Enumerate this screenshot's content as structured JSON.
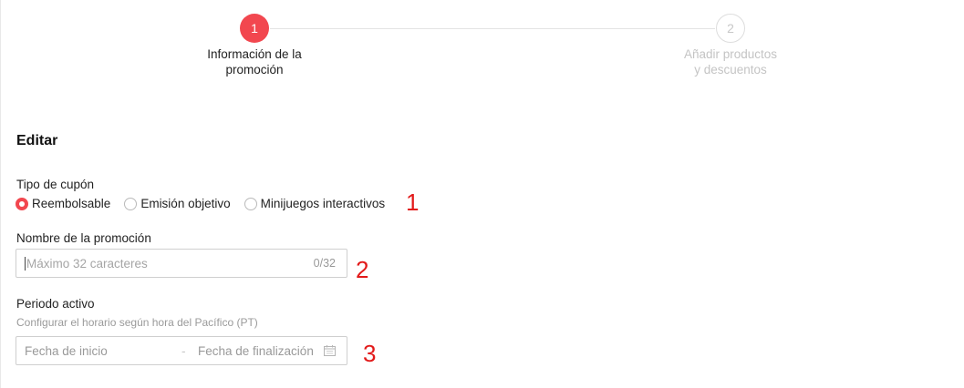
{
  "stepper": {
    "steps": [
      {
        "number": "1",
        "label": "Información de la promoción",
        "state": "active"
      },
      {
        "number": "2",
        "label": "Añadir productos y descuentos",
        "state": "inactive"
      }
    ]
  },
  "form": {
    "title": "Editar",
    "coupon_type": {
      "label": "Tipo de cupón",
      "options": [
        "Reembolsable",
        "Emisión objetivo",
        "Minijuegos interactivos"
      ],
      "selected": "Reembolsable"
    },
    "promotion_name": {
      "label": "Nombre de la promoción",
      "value": "",
      "placeholder": "Máximo 32 caracteres",
      "counter": "0/32"
    },
    "active_period": {
      "label": "Periodo activo",
      "hint": "Configurar el horario según hora del Pacífico (PT)",
      "start_placeholder": "Fecha de inicio",
      "separator": "-",
      "end_placeholder": "Fecha de finalización",
      "icon": "calendar-icon"
    }
  },
  "annotations": [
    "1",
    "2",
    "3"
  ],
  "colors": {
    "accent": "#f2474f",
    "annotation": "#e21a1a"
  }
}
